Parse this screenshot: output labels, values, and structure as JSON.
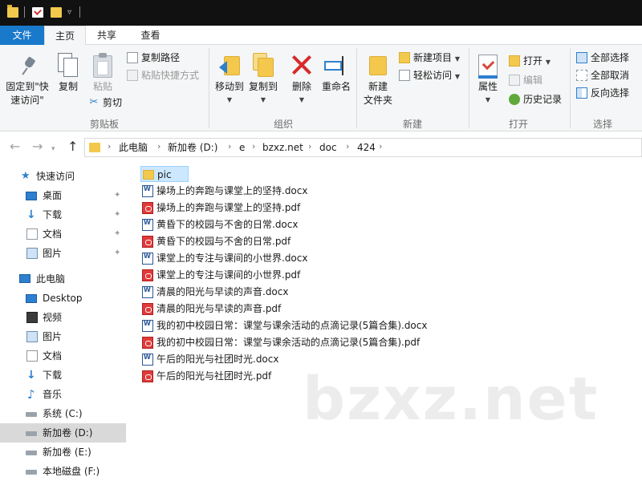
{
  "ribbon_tabs": {
    "file": "文件",
    "home": "主页",
    "share": "共享",
    "view": "查看"
  },
  "ribbon": {
    "clipboard": {
      "pin_line1": "固定到\"快",
      "pin_line2": "速访问\"",
      "copy": "复制",
      "paste": "粘贴",
      "copy_path": "复制路径",
      "paste_shortcut": "粘贴快捷方式",
      "cut": "剪切",
      "label": "剪贴板"
    },
    "organize": {
      "move_to": "移动到",
      "copy_to": "复制到",
      "delete": "删除",
      "rename": "重命名",
      "label": "组织"
    },
    "new": {
      "new_folder_line1": "新建",
      "new_folder_line2": "文件夹",
      "new_item": "新建项目",
      "easy_access": "轻松访问",
      "label": "新建"
    },
    "open": {
      "properties": "属性",
      "open": "打开",
      "edit": "编辑",
      "history": "历史记录",
      "label": "打开"
    },
    "select": {
      "select_all": "全部选择",
      "select_none": "全部取消",
      "invert": "反向选择",
      "label": "选择"
    }
  },
  "address": {
    "crumbs": [
      "此电脑",
      "新加卷 (D:)",
      "e",
      "bzxz.net",
      "doc",
      "424"
    ]
  },
  "sidebar": {
    "quick_access": "快速访问",
    "quick_items": [
      "桌面",
      "下载",
      "文档",
      "图片"
    ],
    "this_pc": "此电脑",
    "pc_items": [
      "Desktop",
      "视频",
      "图片",
      "文档",
      "下载",
      "音乐",
      "系统 (C:)",
      "新加卷 (D:)",
      "新加卷 (E:)",
      "本地磁盘 (F:)"
    ]
  },
  "files": [
    {
      "name": "pic",
      "type": "folder"
    },
    {
      "name": "操场上的奔跑与课堂上的坚持.docx",
      "type": "docx"
    },
    {
      "name": "操场上的奔跑与课堂上的坚持.pdf",
      "type": "pdf"
    },
    {
      "name": "黄昏下的校园与不舍的日常.docx",
      "type": "docx"
    },
    {
      "name": "黄昏下的校园与不舍的日常.pdf",
      "type": "pdf"
    },
    {
      "name": "课堂上的专注与课间的小世界.docx",
      "type": "docx"
    },
    {
      "name": "课堂上的专注与课间的小世界.pdf",
      "type": "pdf"
    },
    {
      "name": "清晨的阳光与早读的声音.docx",
      "type": "docx"
    },
    {
      "name": "清晨的阳光与早读的声音.pdf",
      "type": "pdf"
    },
    {
      "name": "我的初中校园日常：课堂与课余活动的点滴记录(5篇合集).docx",
      "type": "docx"
    },
    {
      "name": "我的初中校园日常：课堂与课余活动的点滴记录(5篇合集).pdf",
      "type": "pdf"
    },
    {
      "name": "午后的阳光与社团时光.docx",
      "type": "docx"
    },
    {
      "name": "午后的阳光与社团时光.pdf",
      "type": "pdf"
    }
  ],
  "watermark": "bzxz.net",
  "colors": {
    "accent": "#1979ca",
    "selection": "#cce8ff",
    "folder": "#f2c94c",
    "pdf": "#e03a3a",
    "word": "#2b5797"
  }
}
